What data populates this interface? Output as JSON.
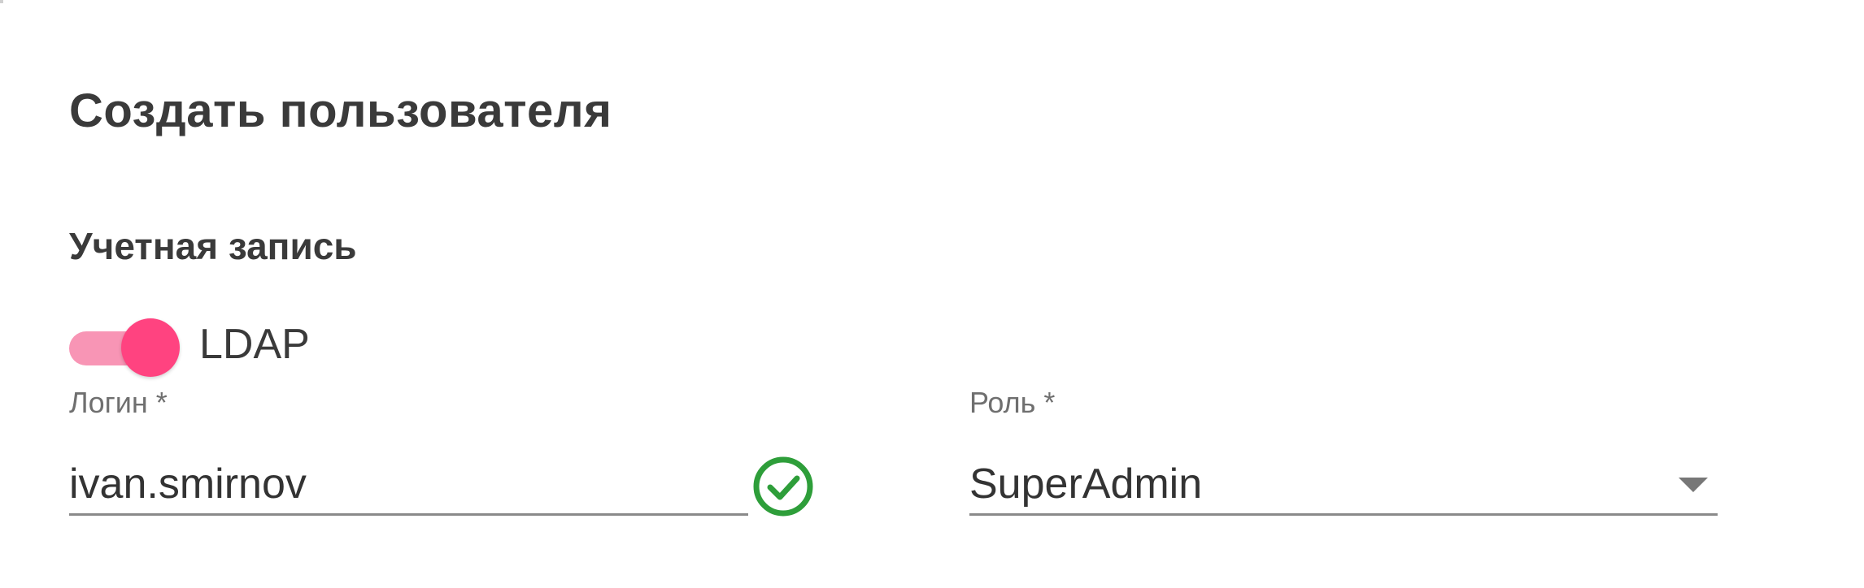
{
  "dialog": {
    "title": "Создать пользователя",
    "section_title": "Учетная запись"
  },
  "ldap_toggle": {
    "label": "LDAP",
    "enabled": true,
    "track_color": "#f895b5",
    "thumb_color": "#ff4380"
  },
  "login_field": {
    "label": "Логин *",
    "value": "ivan.smirnov",
    "valid_icon": "check-circle-icon",
    "valid_color": "#2e9e3a"
  },
  "role_field": {
    "label": "Роль *",
    "value": "SuperAdmin",
    "dropdown_icon": "chevron-down-icon"
  }
}
